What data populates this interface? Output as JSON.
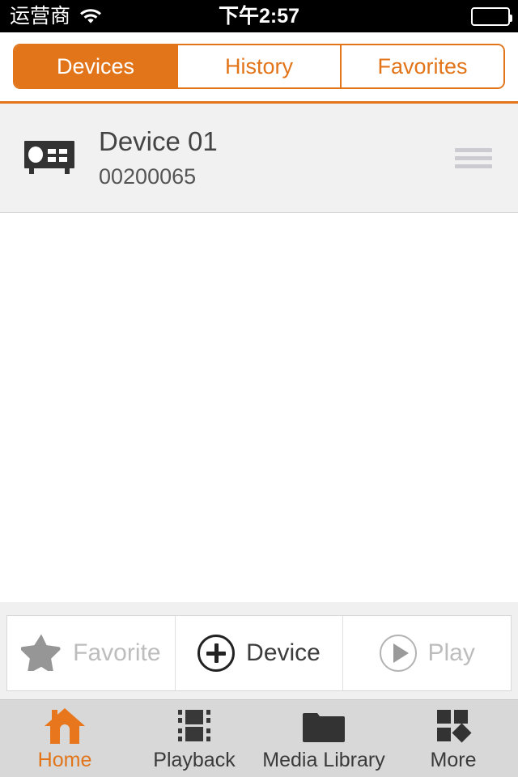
{
  "status_bar": {
    "carrier": "运营商",
    "wifi_icon": "wifi-icon",
    "time": "下午2:57",
    "battery_icon": "battery-icon"
  },
  "segmented_control": {
    "selected": "Devices",
    "segments": [
      {
        "label": "Devices",
        "active": true
      },
      {
        "label": "History",
        "active": false
      },
      {
        "label": "Favorites",
        "active": false
      }
    ]
  },
  "device_list": {
    "rows": [
      {
        "icon": "dvr-device-icon",
        "title": "Device 01",
        "serial": "00200065",
        "handle_icon": "drag-handle-icon"
      }
    ]
  },
  "action_toolbar": {
    "items": [
      {
        "label": "Favorite",
        "icon": "star-icon",
        "enabled": false
      },
      {
        "label": "Device",
        "icon": "plus-circle-icon",
        "enabled": true
      },
      {
        "label": "Play",
        "icon": "play-circle-icon",
        "enabled": false
      }
    ]
  },
  "tab_bar": {
    "active": "Home",
    "tabs": [
      {
        "label": "Home",
        "icon": "home-icon",
        "active": true
      },
      {
        "label": "Playback",
        "icon": "film-strip-icon",
        "active": false
      },
      {
        "label": "Media Library",
        "icon": "folder-icon",
        "active": false
      },
      {
        "label": "More",
        "icon": "grid-more-icon",
        "active": false
      }
    ]
  },
  "colors": {
    "accent": "#e2751a",
    "status_bar_bg": "#000000",
    "row_bg": "#f1f1f1",
    "tabbar_bg": "#d8d8d8",
    "disabled_text": "#bdbdbd"
  }
}
